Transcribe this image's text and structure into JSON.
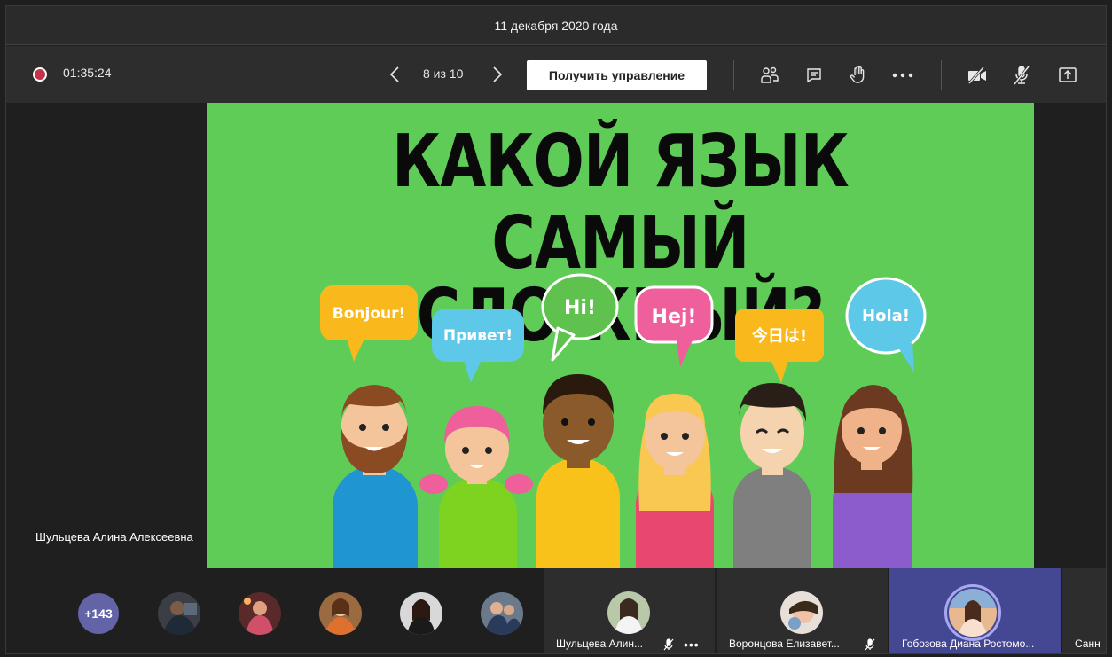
{
  "window": {
    "title": "11 декабря 2020 года"
  },
  "toolbar": {
    "timer": "01:35:24",
    "pager": "8 из 10",
    "take_control_label": "Получить управление"
  },
  "slide": {
    "title_line1": "КАКОЙ ЯЗЫК",
    "title_line2": "САМЫЙ СЛОЖНЫЙ?",
    "bubbles": [
      "Bonjour!",
      "Привет!",
      "Hi!",
      "Hej!",
      "今日は!",
      "Hola!"
    ]
  },
  "presenter": {
    "name": "Шульцева Алина Алексеевна"
  },
  "participants": {
    "more_count": "+143",
    "tiles": [
      {
        "name": "Шульцева Алин..."
      },
      {
        "name": "Воронцова Елизавет..."
      },
      {
        "name": "Гобозова Диана Ростомо..."
      },
      {
        "name": "Санн"
      }
    ]
  },
  "colors": {
    "slide_bg": "#60cc58",
    "accent": "#6264a7",
    "recording": "#c4314b",
    "bubble_yellow": "#f9b81b",
    "bubble_blue": "#5ec8e8",
    "bubble_green": "#5fc24e",
    "bubble_pink": "#ee5f9c",
    "bubble_orange": "#f9b81b",
    "bubble_sky": "#5ec8e8"
  },
  "icons": [
    "record-icon",
    "chevron-left-icon",
    "chevron-right-icon",
    "participants-icon",
    "chat-icon",
    "raise-hand-icon",
    "more-icon",
    "camera-off-icon",
    "mic-off-icon",
    "share-screen-icon"
  ]
}
